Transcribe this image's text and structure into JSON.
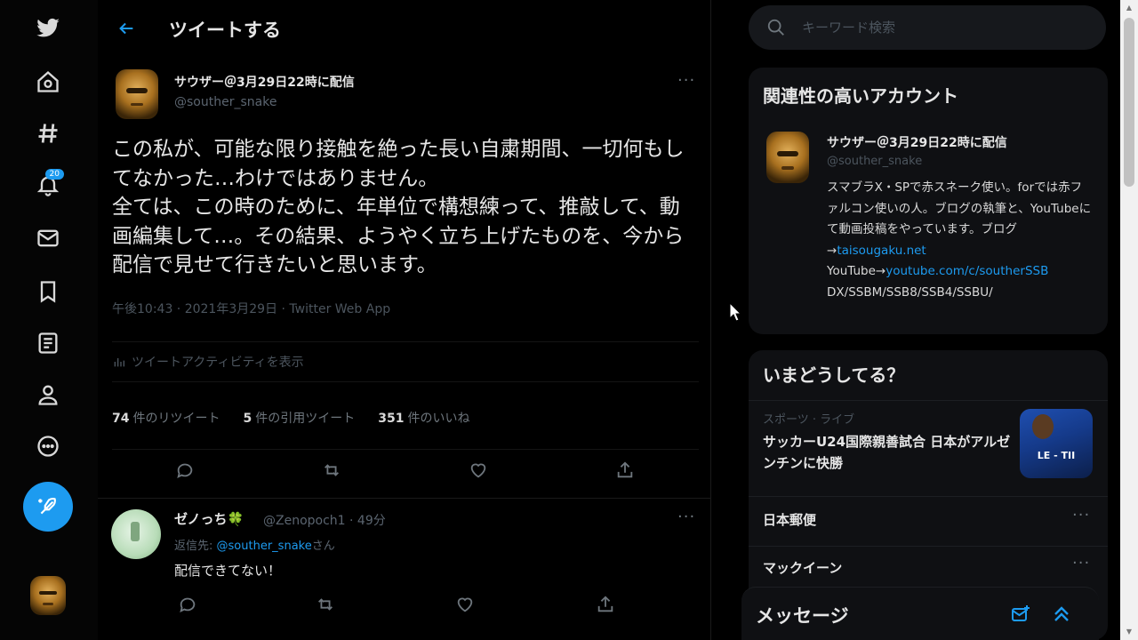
{
  "app": {
    "logo": "twitter-bird-icon",
    "accent_color": "#1d9bf0",
    "background_color": "#000000"
  },
  "nav": {
    "items": [
      {
        "icon": "home-icon"
      },
      {
        "icon": "hashtag-icon"
      },
      {
        "icon": "bell-icon",
        "badge": "20"
      },
      {
        "icon": "mail-icon"
      },
      {
        "icon": "bookmark-icon"
      },
      {
        "icon": "list-icon"
      },
      {
        "icon": "profile-icon"
      },
      {
        "icon": "more-circle-icon"
      }
    ],
    "compose_icon": "feather-plus-icon"
  },
  "header": {
    "title": "ツイートする"
  },
  "tweet": {
    "name": "サウザー＠3月29日22時に配信",
    "handle": "@souther_snake",
    "text": "この私が、可能な限り接触を絶った長い自粛期間、一切何もしてなかった…わけではありません。\n全ては、この時のために、年単位で構想練って、推敲して、動画編集して…。その結果、ようやく立ち上げたものを、今から配信で見せて行きたいと思います。",
    "meta": "午後10:43 · 2021年3月29日 · Twitter Web App",
    "activity_label": "ツイートアクティビティを表示",
    "retweets": "74",
    "retweets_label": "件のリツイート",
    "quotes": "5",
    "quotes_label": "件の引用ツイート",
    "likes": "351",
    "likes_label": "件のいいね"
  },
  "reply": {
    "name": "ゼノっち🍀",
    "handle": "@Zenopoch1 · 49分",
    "to_prefix": "返信先:",
    "to_handle": "@souther_snake",
    "to_suffix": "さん",
    "text": "配信できてない！"
  },
  "search": {
    "placeholder": "キーワード検索"
  },
  "related": {
    "title": "関連性の高いアカウント",
    "name": "サウザー＠3月29日22時に配信",
    "handle": "@souther_snake",
    "bio": "スマブラX・SPで赤スネーク使い。forでは赤ファルコン使いの人。ブログの執筆と、YouTubeにて動画投稿をやっています。ブログ→",
    "blog_link": "taisougaku.net",
    "youtube_label": "YouTube→",
    "youtube_link": "youtube.com/c/southerSSB",
    "games": "DX/SSBM/SSB8/SSB4/SSBU/"
  },
  "trends": {
    "title": "いまどうしてる？",
    "items": [
      {
        "category": "スポーツ · ライブ",
        "name": "サッカーU24国際親善試合 日本がアルゼンチンに快勝"
      },
      {
        "category": "",
        "name": "日本郵便"
      },
      {
        "category": "",
        "name": "マックイーン"
      }
    ]
  },
  "messages": {
    "title": "メッセージ"
  }
}
